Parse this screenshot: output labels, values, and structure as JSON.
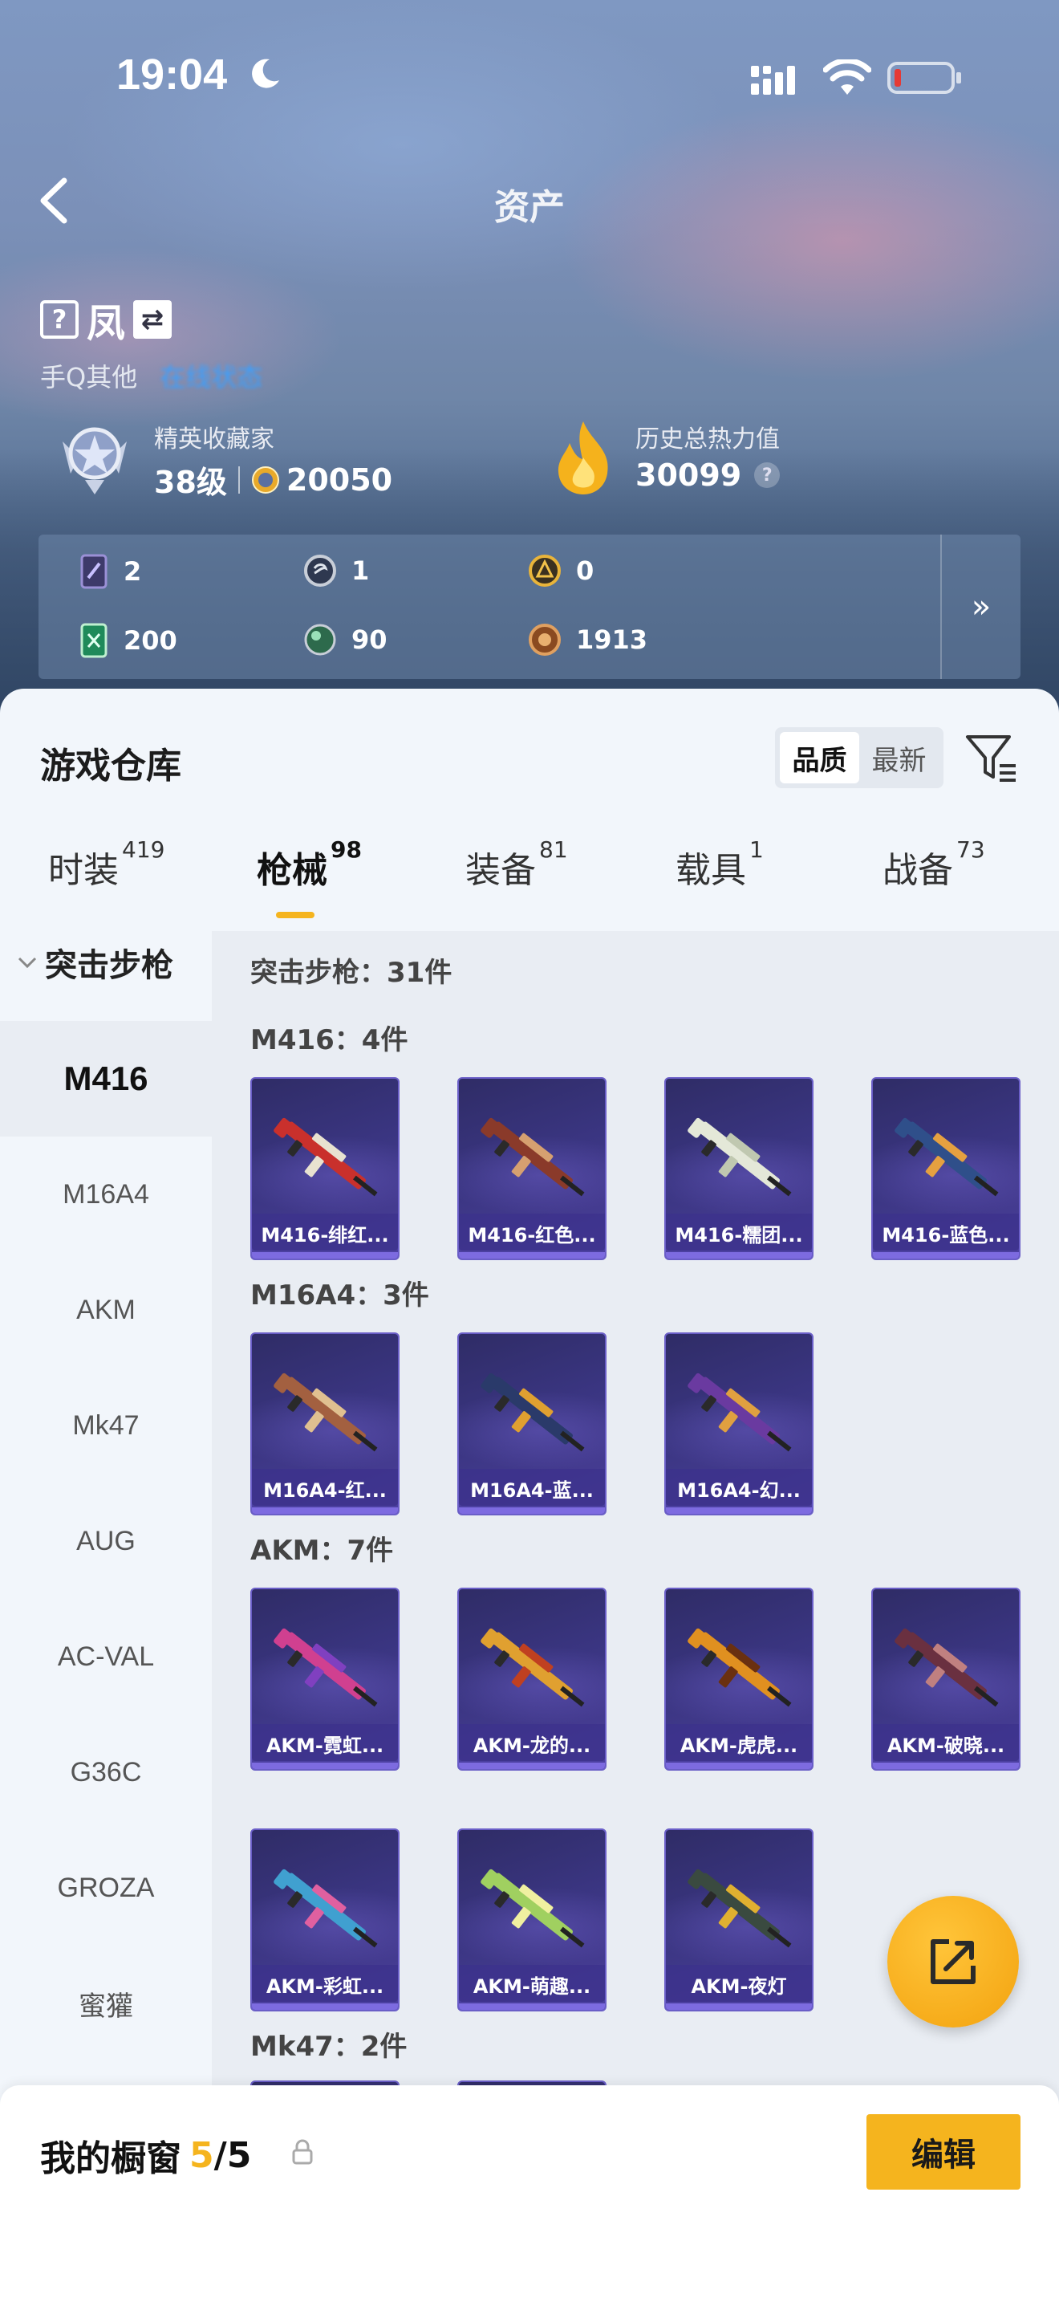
{
  "status": {
    "time": "19:04"
  },
  "nav": {
    "title": "资产"
  },
  "profile": {
    "name": "凤",
    "platform": "手Q其他",
    "platform_link": "在线状态"
  },
  "stats": {
    "rank_label": "精英收藏家",
    "level": "38级",
    "points": "20050",
    "heat_label": "历史总热力值",
    "heat_value": "30099",
    "heat_help": "?"
  },
  "resources": [
    {
      "icon": "card-icon",
      "value": "2"
    },
    {
      "icon": "silver-coin-icon",
      "value": "1"
    },
    {
      "icon": "gold-coin-icon",
      "value": "0"
    },
    {
      "icon": "green-ticket-icon",
      "value": "200"
    },
    {
      "icon": "orb-icon",
      "value": "90"
    },
    {
      "icon": "bronze-coin-icon",
      "value": "1913"
    }
  ],
  "resources_more": "»",
  "warehouse": {
    "title": "游戏仓库",
    "sort": [
      "品质",
      "最新"
    ],
    "tabs": [
      {
        "label": "时装",
        "count": "419"
      },
      {
        "label": "枪械",
        "count": "98"
      },
      {
        "label": "装备",
        "count": "81"
      },
      {
        "label": "载具",
        "count": "1"
      },
      {
        "label": "战备",
        "count": "73"
      }
    ]
  },
  "sidebar": {
    "category": "突击步枪",
    "items": [
      "M416",
      "M16A4",
      "AKM",
      "Mk47",
      "AUG",
      "AC-VAL",
      "G36C",
      "GROZA",
      "蜜獾"
    ]
  },
  "content": {
    "total": "突击步枪：31件",
    "groups": [
      {
        "label": "M416：4件",
        "items": [
          "M416-绯红...",
          "M416-红色...",
          "M416-糯团...",
          "M416-蓝色..."
        ]
      },
      {
        "label": "M16A4：3件",
        "items": [
          "M16A4-红...",
          "M16A4-蓝...",
          "M16A4-幻..."
        ]
      },
      {
        "label": "AKM：7件",
        "items": [
          "AKM-霓虹...",
          "AKM-龙的...",
          "AKM-虎虎...",
          "AKM-破晓...",
          "AKM-彩虹...",
          "AKM-萌趣...",
          "AKM-夜灯"
        ]
      },
      {
        "label": "Mk47：2件",
        "items": []
      }
    ]
  },
  "gun_colors": [
    [
      "#c9302c",
      "#e8e2d0"
    ],
    [
      "#8a3a2a",
      "#d6a070"
    ],
    [
      "#e4e8d8",
      "#c0c8b0"
    ],
    [
      "#2f4f8a",
      "#e5a040"
    ],
    [
      "#a36040",
      "#e0c090"
    ],
    [
      "#2a3a6a",
      "#e0a030"
    ],
    [
      "#6a3aa0",
      "#e0a040"
    ],
    [
      "#d04090",
      "#8040c0"
    ],
    [
      "#e0a030",
      "#c04020"
    ],
    [
      "#e09020",
      "#6a3010"
    ],
    [
      "#6a3040",
      "#c08080"
    ],
    [
      "#40a0d0",
      "#e060a0"
    ],
    [
      "#a0d060",
      "#f0f0a0"
    ],
    [
      "#3a4a40",
      "#e0b030"
    ]
  ],
  "bottom": {
    "title": "我的橱窗",
    "current": "5",
    "total": "/5",
    "edit": "编辑"
  }
}
